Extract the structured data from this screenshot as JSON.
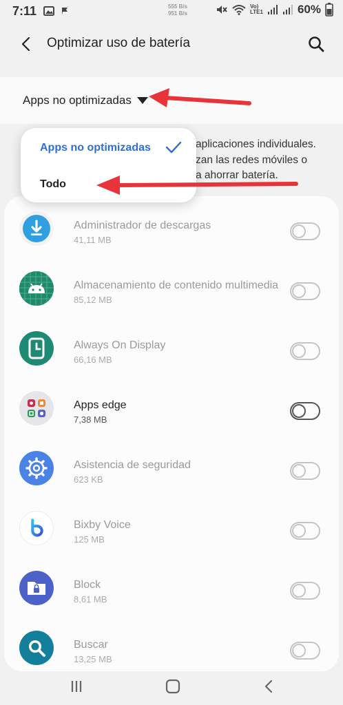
{
  "status_bar": {
    "time": "7:11",
    "net_up": "555 B/s",
    "net_down": "951 B/s",
    "volte": "Vo)",
    "lte": "LTE1",
    "battery": "60%"
  },
  "app_bar": {
    "title": "Optimizar uso de batería"
  },
  "filter": {
    "selected": "Apps no optimizadas"
  },
  "description": {
    "line1": "aplicaciones individuales.",
    "line2": "zan las redes móviles o",
    "line3": "a ahorrar batería."
  },
  "popup": {
    "options": [
      "Apps no optimizadas",
      "Todo"
    ]
  },
  "apps": [
    {
      "name": "Administrador de descargas",
      "size": "41,11 MB",
      "enabled": false,
      "icon": "download-icon",
      "color": "#2f9fe0"
    },
    {
      "name": "Almacenamiento de contenido multimedia",
      "size": "85,12 MB",
      "enabled": false,
      "icon": "android-icon",
      "color": "#1f8a6a"
    },
    {
      "name": "Always On Display",
      "size": "66,16 MB",
      "enabled": false,
      "icon": "clock-icon",
      "color": "#1f8a74"
    },
    {
      "name": "Apps edge",
      "size": "7,38 MB",
      "enabled": true,
      "icon": "apps-grid-icon",
      "color": "#e8e8ec"
    },
    {
      "name": "Asistencia de seguridad",
      "size": "623 KB",
      "enabled": false,
      "icon": "gear-icon",
      "color": "#4b82e6"
    },
    {
      "name": "Bixby Voice",
      "size": "125 MB",
      "enabled": false,
      "icon": "bixby-icon",
      "color": "#ffffff"
    },
    {
      "name": "Block",
      "size": "8,61 MB",
      "enabled": false,
      "icon": "folder-lock-icon",
      "color": "#4c62c8"
    },
    {
      "name": "Buscar",
      "size": "13,25 MB",
      "enabled": false,
      "icon": "search-app-icon",
      "color": "#147f9a"
    }
  ],
  "colors": {
    "accent": "#2d6fd5",
    "annotation": "#e8333a"
  }
}
